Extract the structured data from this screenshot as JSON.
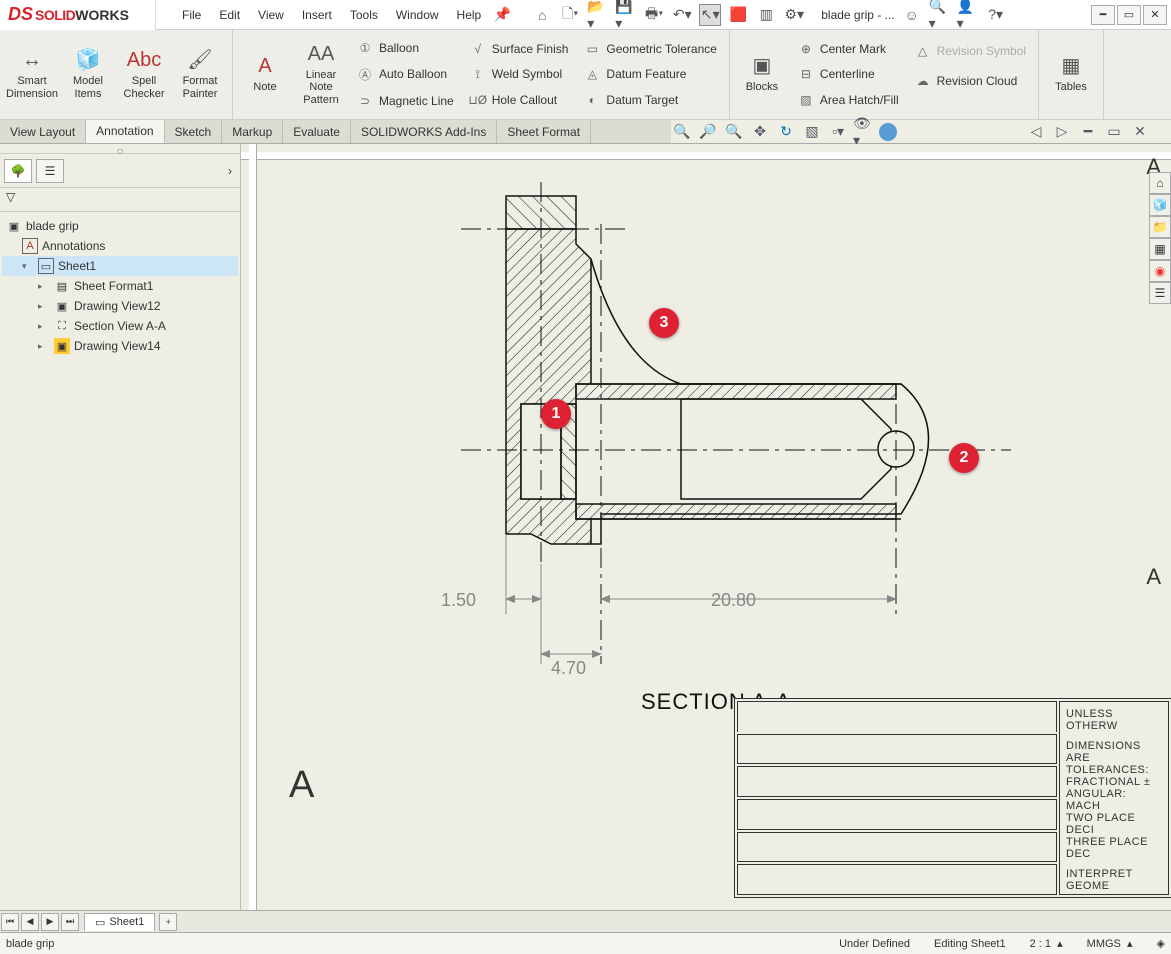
{
  "app": {
    "logo1": "SOLID",
    "logo2": "WORKS"
  },
  "menu": {
    "file": "File",
    "edit": "Edit",
    "view": "View",
    "insert": "Insert",
    "tools": "Tools",
    "window": "Window",
    "help": "Help"
  },
  "qat": {
    "doc": "blade grip - ..."
  },
  "ribbon": {
    "smart_dim": "Smart Dimension",
    "model_items": "Model Items",
    "spell": "Spell Checker",
    "format": "Format Painter",
    "note": "Note",
    "lnp": "Linear Note Pattern",
    "balloon": "Balloon",
    "auto_balloon": "Auto Balloon",
    "magnetic": "Magnetic Line",
    "surface": "Surface Finish",
    "weld": "Weld Symbol",
    "hole": "Hole Callout",
    "geo_tol": "Geometric Tolerance",
    "datum_feat": "Datum Feature",
    "datum_targ": "Datum Target",
    "blocks": "Blocks",
    "center_mark": "Center Mark",
    "centerline": "Centerline",
    "area_hatch": "Area Hatch/Fill",
    "rev_symbol": "Revision Symbol",
    "rev_cloud": "Revision Cloud",
    "tables": "Tables"
  },
  "tabs": {
    "view_layout": "View Layout",
    "annotation": "Annotation",
    "sketch": "Sketch",
    "markup": "Markup",
    "evaluate": "Evaluate",
    "addins": "SOLIDWORKS Add-Ins",
    "sheet_format": "Sheet Format"
  },
  "tree": {
    "root": "blade grip",
    "annotations": "Annotations",
    "sheet1": "Sheet1",
    "sheet_format": "Sheet Format1",
    "dv12": "Drawing View12",
    "section": "Section View A-A",
    "dv14": "Drawing View14"
  },
  "drawing": {
    "dim1": "1.50",
    "dim2": "4.70",
    "dim3": "20.80",
    "title": "SECTION A-A",
    "letterA": "A",
    "letterA2": "A"
  },
  "markers": {
    "m1": "1",
    "m2": "2",
    "m3": "3"
  },
  "titleblock": {
    "l1": "UNLESS OTHERW",
    "l2": "DIMENSIONS ARE",
    "l3": "TOLERANCES:",
    "l4": "FRACTIONAL ±",
    "l5": "ANGULAR: MACH",
    "l6": "TWO PLACE DECI",
    "l7": "THREE PLACE DEC",
    "l8": "INTERPRET GEOME"
  },
  "bottom": {
    "sheet": "Sheet1"
  },
  "status": {
    "doc": "blade grip",
    "under": "Under Defined",
    "editing": "Editing Sheet1",
    "scale": "2 : 1",
    "units": "MMGS"
  }
}
